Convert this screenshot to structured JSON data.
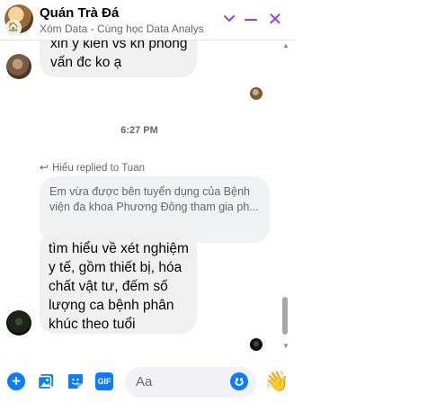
{
  "header": {
    "title": "Quán Trà Đá",
    "subtitle": "Xóm Data - Cùng học Data Analys",
    "close_glyph": "✕",
    "chevron_glyph": "⌄",
    "badge_glyph": "🏠"
  },
  "messages": [
    {
      "id": "m1",
      "text": "xin ý kiến vs kn phỏng vấn đc ko ạ"
    },
    {
      "id": "m2",
      "text": "tìm hiểu về xét nghiệm y tế, gồm thiết bị, hóa chất vật tư, đếm số lượng ca bệnh phân khúc theo tuổi"
    }
  ],
  "timestamp": "6:27 PM",
  "reply": {
    "header": "Hiếu replied to Tuan",
    "quoted": "Em vừa được bên tuyển dụng của Bệnh viện đa khoa Phương Đông tham gia ph..."
  },
  "composer": {
    "placeholder": "Aa",
    "gif_label": "GIF",
    "plus_glyph": "+",
    "wave_glyph": "👋"
  },
  "icons": {
    "plus": "plus-icon",
    "image": "image-icon",
    "sticker": "sticker-icon",
    "gif": "gif-icon",
    "emoji": "emoji-icon",
    "wave": "wave-icon",
    "close": "close-icon",
    "minimize": "minimize-icon",
    "chevron": "chevron-down-icon"
  },
  "colors": {
    "accent": "#a334fa",
    "blue": "#0a7cff",
    "bubble": "#f0f0f0"
  }
}
